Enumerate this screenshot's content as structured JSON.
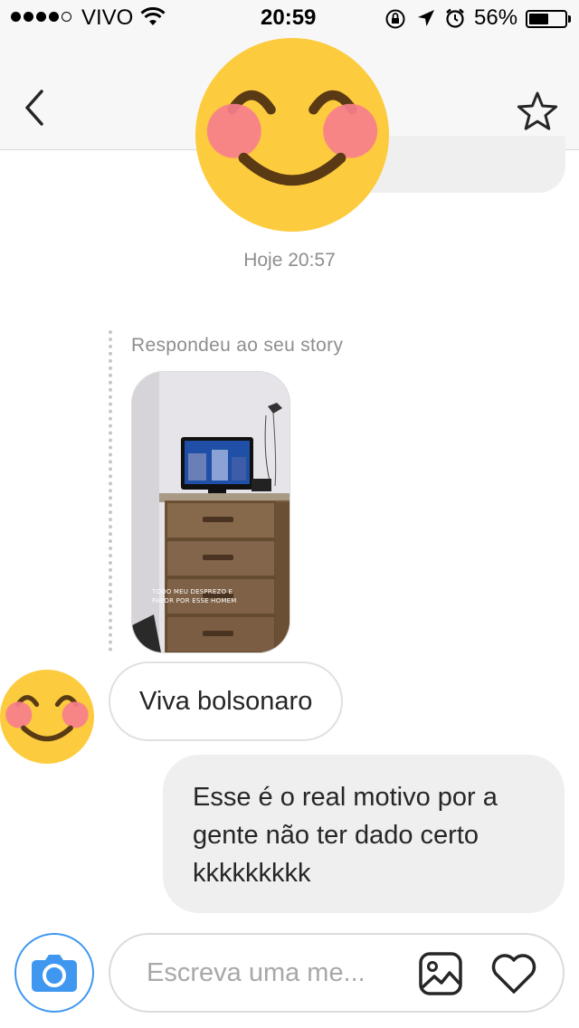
{
  "status_bar": {
    "carrier": "VIVO",
    "time": "20:59",
    "battery": "56%",
    "battery_level": 0.56,
    "signal_bars_filled": 4,
    "signal_bars_total": 5
  },
  "header": {
    "back_icon": "chevron-left-icon",
    "favorite_icon": "star-outline-icon",
    "avatar_emoji": "smiling-blushing-face"
  },
  "messages": {
    "timestamp": "Hoje 20:57",
    "story_reply": {
      "label": "Respondeu ao seu story",
      "story_caption_line1": "TODO MEU DESPREZO E",
      "story_caption_line2": "PAVOR POR ESSE HOMEM"
    },
    "incoming_text": "Viva bolsonaro",
    "outgoing_text_lines": [
      "Esse é o real motivo por a",
      "gente não ter dado certo",
      "kkkkkkkkk"
    ]
  },
  "composer": {
    "placeholder": "Escreva uma me...",
    "camera_icon": "camera-icon",
    "gallery_icon": "image-icon",
    "like_icon": "heart-outline-icon"
  },
  "colors": {
    "accent_blue": "#3f97f0",
    "bubble_grey": "#efefef",
    "emoji_yellow": "#fdcb3e",
    "emoji_blush": "#f77f8c"
  }
}
